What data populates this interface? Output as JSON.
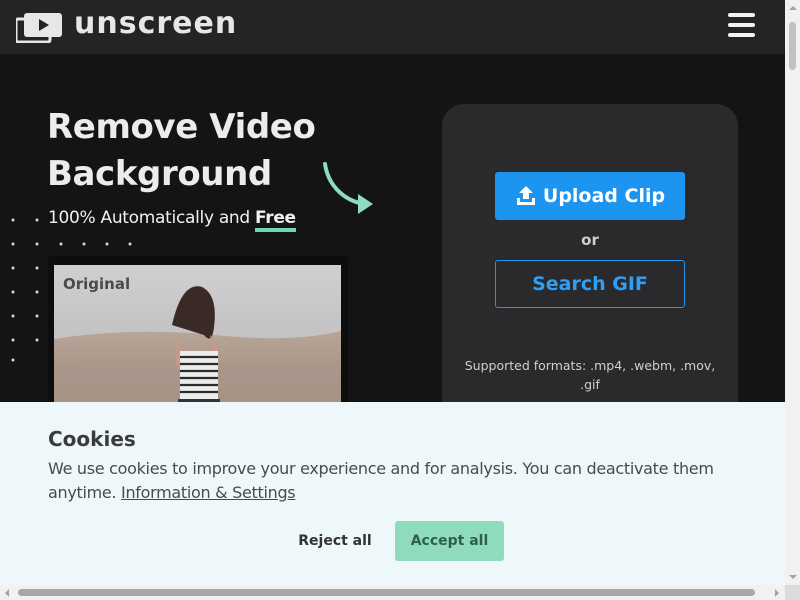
{
  "header": {
    "brand": "unscreen",
    "logo_icon": "video-play-stack-icon",
    "menu_icon": "hamburger-menu-icon"
  },
  "hero": {
    "title": "Remove Video Background",
    "subtitle_prefix": "100% Automatically and ",
    "subtitle_highlight": "Free",
    "preview_label": "Original",
    "arrow_icon": "curved-arrow-icon"
  },
  "upload": {
    "upload_label": "Upload Clip",
    "upload_icon": "upload-icon",
    "or_text": "or",
    "search_label": "Search GIF",
    "formats_text": "Supported formats: .mp4, .webm, .mov, .gif"
  },
  "cookie": {
    "title": "Cookies",
    "text": "We use cookies to improve your experience and for analysis. You can deactivate them anytime. ",
    "link_text": "Information & Settings",
    "reject_label": "Reject all",
    "accept_label": "Accept all"
  },
  "colors": {
    "accent_blue": "#1e94f1",
    "accent_green": "#8fdcbd",
    "highlight_green": "#6fd7b1",
    "dark_bg": "#141416",
    "card_bg": "#2a2a2c"
  }
}
